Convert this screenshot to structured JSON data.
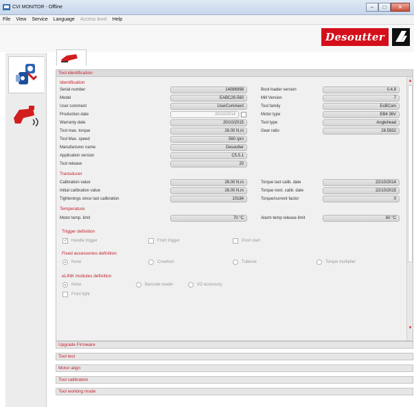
{
  "window": {
    "title": "CVI MONITOR - Offline",
    "minimize_icon": "minimize-icon",
    "maximize_icon": "maximize-icon",
    "close_icon": "close-icon"
  },
  "menu": [
    "File",
    "View",
    "Service",
    "Language",
    "Access level",
    "Help"
  ],
  "menu_disabled": [
    "Access level"
  ],
  "brand": {
    "logo_text": "Desoutter",
    "color": "#d40f1b"
  },
  "nav": [
    {
      "icon": "tool-settings-icon",
      "active": true
    },
    {
      "icon": "wireless-tool-icon",
      "active": false
    }
  ],
  "tab": {
    "icon": "tool-tab-icon"
  },
  "sections": {
    "tool_identification": "Tool identification",
    "collapsed": [
      "Upgrade Firmware",
      "Tool test",
      "Motor align",
      "Tool calibration",
      "Tool working mode"
    ]
  },
  "identification": {
    "title": "Identification",
    "left": [
      {
        "label": "Serial number",
        "value": "14086998"
      },
      {
        "label": "Model",
        "value": "EABC26-560"
      },
      {
        "label": "User comment",
        "value": "UserComment"
      },
      {
        "label": "Production date",
        "value": "20/10/2014",
        "readonly": true
      },
      {
        "label": "Warranty date",
        "value": "20/10/2015"
      },
      {
        "label": "Tool max. torque",
        "value": "26.00 N.m"
      },
      {
        "label": "Tool Max. speed",
        "value": "560 rpm"
      },
      {
        "label": "Manufacturer name",
        "value": "Desoutter"
      },
      {
        "label": "Application version",
        "value": "C5.5.1"
      },
      {
        "label": "Tool release",
        "value": "20"
      }
    ],
    "right": [
      {
        "label": "Boot loader version",
        "value": "0.4.8"
      },
      {
        "label": "Mill Version",
        "value": "7"
      },
      {
        "label": "Tool family",
        "value": "ExBCom"
      },
      {
        "label": "Motor type",
        "value": "EB4 36V"
      },
      {
        "label": "Tool type",
        "value": "Anglehead"
      },
      {
        "label": "Gear ratio",
        "value": "28.5932"
      }
    ]
  },
  "transducer": {
    "title": "Transducer",
    "left": [
      {
        "label": "Calibration value",
        "value": "26.00 N.m"
      },
      {
        "label": "Initial calibration value",
        "value": "26.00 N.m"
      },
      {
        "label": "Tightenings since last calibration",
        "value": "10184"
      }
    ],
    "right": [
      {
        "label": "Torque last calib. date",
        "value": "22/10/2014"
      },
      {
        "label": "Torque next. calib. date",
        "value": "22/10/2015"
      },
      {
        "label": "Torque/current factor",
        "value": "0"
      }
    ]
  },
  "temperature": {
    "title": "Temperature",
    "left": {
      "label": "Motor temp. limit",
      "value": "70 °C"
    },
    "right": {
      "label": "Alarm temp release limit",
      "value": "60 °C"
    }
  },
  "trigger": {
    "title": "Trigger definition",
    "options": [
      "Handle trigger",
      "Front trigger",
      "Push start"
    ],
    "checked": [
      true,
      false,
      false
    ]
  },
  "fixed_accessories": {
    "title": "Fixed accessories definition",
    "options": [
      "None",
      "Crowfoot",
      "Tubenut",
      "Torque multiplier"
    ],
    "selected": "None"
  },
  "elink": {
    "title": "eLINK modules definition",
    "options": [
      "None",
      "Barcode reader",
      "I/O accessory"
    ],
    "selected": "None",
    "partial_label": "Front light"
  }
}
